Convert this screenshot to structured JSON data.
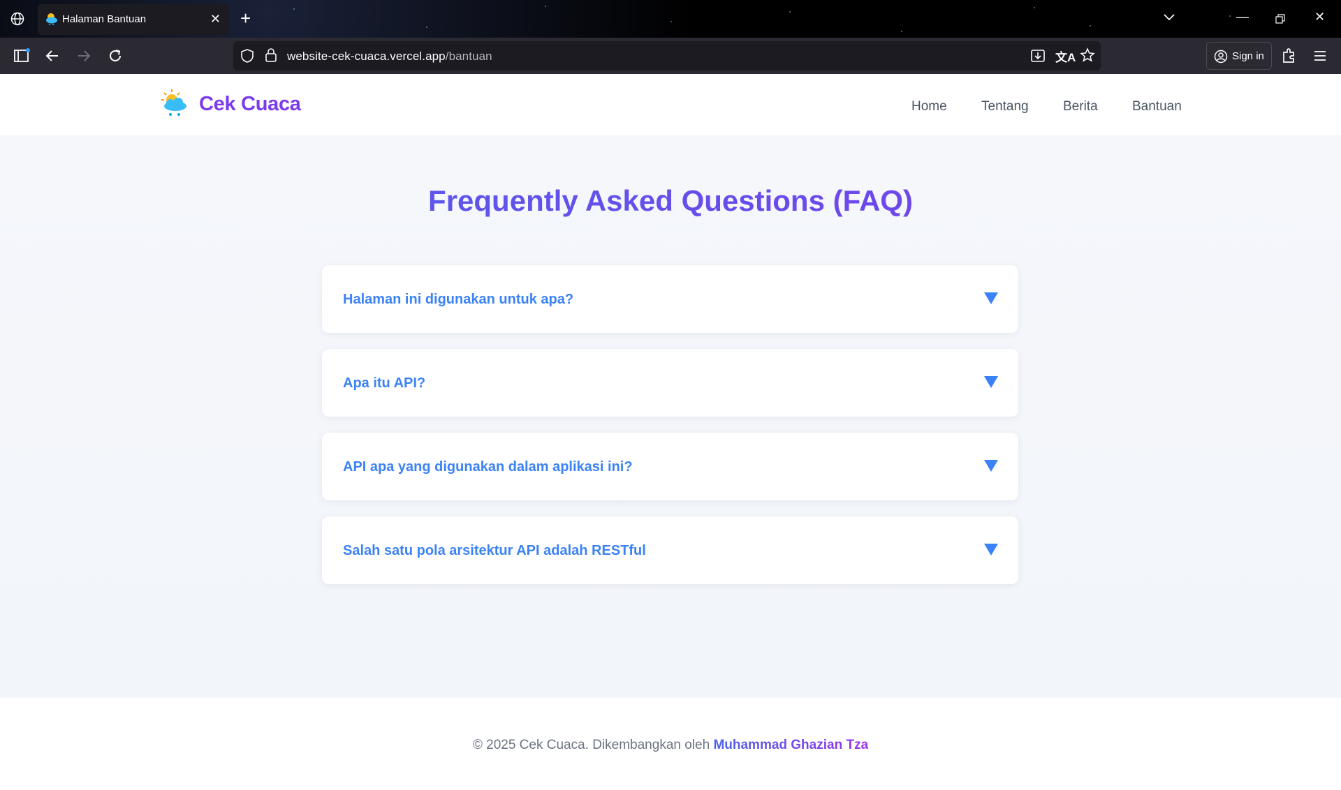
{
  "browser": {
    "tab_title": "Halaman Bantuan",
    "url_host": "website-cek-cuaca.vercel.app",
    "url_path": "/bantuan",
    "signin_label": "Sign in"
  },
  "header": {
    "brand": "Cek Cuaca",
    "nav": [
      "Home",
      "Tentang",
      "Berita",
      "Bantuan"
    ]
  },
  "main": {
    "title": "Frequently Asked Questions (FAQ)",
    "faqs": [
      "Halaman ini digunakan untuk apa?",
      "Apa itu API?",
      "API apa yang digunakan dalam aplikasi ini?",
      "Salah satu pola arsitektur API adalah RESTful"
    ]
  },
  "footer": {
    "text": "© 2025 Cek Cuaca. Dikembangkan oleh ",
    "author": "Muhammad Ghazian Tza"
  },
  "colors": {
    "brand": "#7c3aed",
    "faq_accent": "#3b82f6",
    "title_gradient_start": "#4f63e8"
  }
}
